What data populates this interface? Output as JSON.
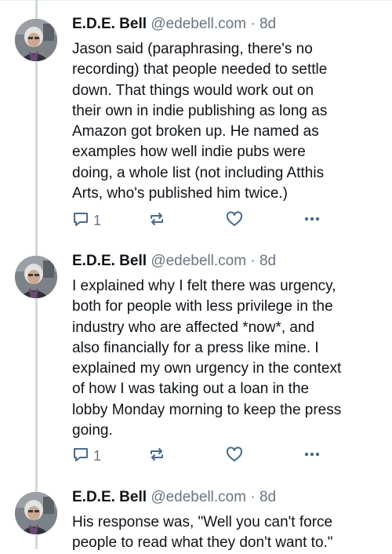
{
  "posts": [
    {
      "author": {
        "name": "E.D.E. Bell",
        "handle": "@edebell.com",
        "separator": "·",
        "time": "8d"
      },
      "text": "Jason said (paraphrasing, there's no\nrecording) that people needed to settle\ndown. That things would work out on\ntheir own in indie publishing as long as\nAmazon got broken up. He named as\nexamples how well indie pubs were\ndoing, a whole list (not including Atthis\nArts, who's published him twice.)",
      "reply_count": "1",
      "icons": {
        "reply": "reply-icon",
        "repost": "repost-icon",
        "like": "heart-icon",
        "more": "more-icon"
      }
    },
    {
      "author": {
        "name": "E.D.E. Bell",
        "handle": "@edebell.com",
        "separator": "·",
        "time": "8d"
      },
      "text": "I explained why I felt there was urgency,\nboth for people with less privilege in the\nindustry who are affected *now*, and\nalso financially for a press like mine. I\nexplained my own urgency in the context\nof how I was taking out a loan in the\nlobby Monday morning to keep the press\ngoing.",
      "reply_count": "1",
      "icons": {
        "reply": "reply-icon",
        "repost": "repost-icon",
        "like": "heart-icon",
        "more": "more-icon"
      }
    },
    {
      "author": {
        "name": "E.D.E. Bell",
        "handle": "@edebell.com",
        "separator": "·",
        "time": "8d"
      },
      "text": "His response was, \"Well you can't force\npeople to read what they don't want to.\""
    }
  ],
  "colors": {
    "text": "#0f1419",
    "muted": "#687684",
    "thread_line": "#cfd9de",
    "icon": "#4b6a8c"
  }
}
